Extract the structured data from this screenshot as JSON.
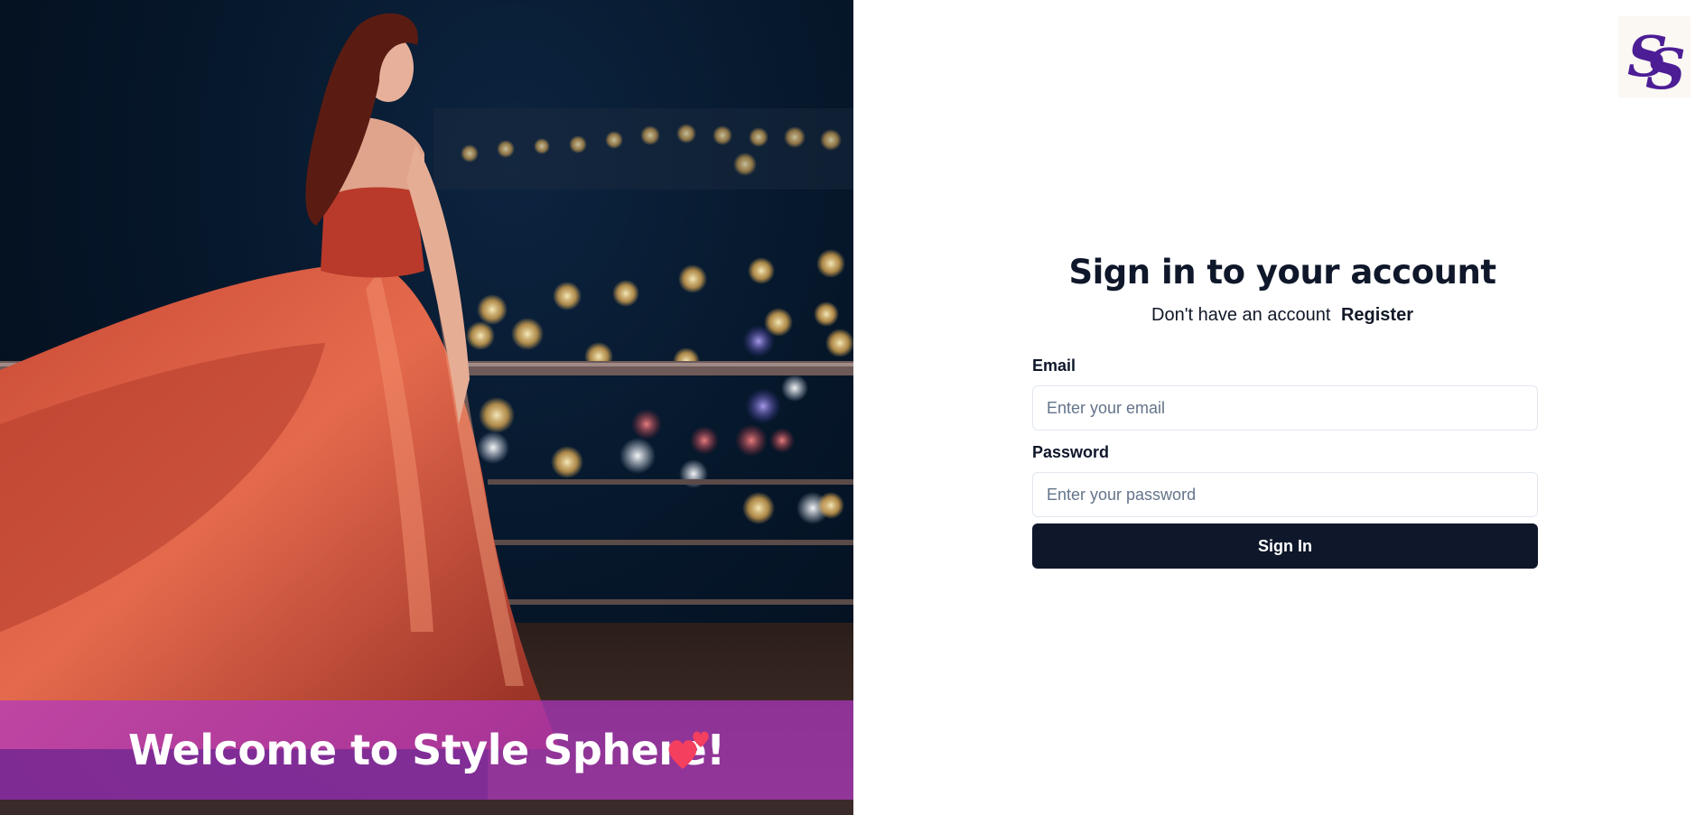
{
  "hero": {
    "welcome_text": "Welcome to Style Sphere!",
    "banner_color": "#b038c4",
    "heart_color": "#f43f5e"
  },
  "logo": {
    "letters": "SS",
    "color": "#4c1d95"
  },
  "form": {
    "title": "Sign in to your account",
    "subtitle_text": "Don't have an account",
    "register_label": "Register",
    "email_label": "Email",
    "email_placeholder": "Enter your email",
    "password_label": "Password",
    "password_placeholder": "Enter your password",
    "submit_label": "Sign In",
    "button_color": "#0f172a"
  }
}
